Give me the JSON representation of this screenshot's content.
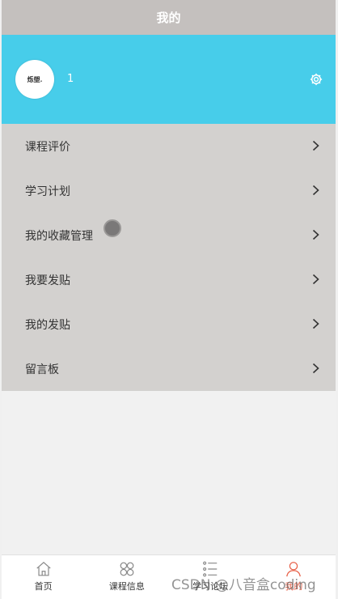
{
  "header": {
    "title": "我的"
  },
  "profile": {
    "avatar_text": "烁塑.",
    "username": "1",
    "settings_icon": "gear-icon",
    "background": "#47cdea"
  },
  "menu": {
    "items": [
      {
        "label": "课程评价",
        "icon": "chevron-right-icon"
      },
      {
        "label": "学习计划",
        "icon": "chevron-right-icon"
      },
      {
        "label": "我的收藏管理",
        "icon": "chevron-right-icon"
      },
      {
        "label": "我要发贴",
        "icon": "chevron-right-icon"
      },
      {
        "label": "我的发贴",
        "icon": "chevron-right-icon"
      },
      {
        "label": "留言板",
        "icon": "chevron-right-icon"
      }
    ]
  },
  "tabbar": {
    "tabs": [
      {
        "label": "首页",
        "icon": "home-icon",
        "active": false
      },
      {
        "label": "课程信息",
        "icon": "grid-icon",
        "active": false
      },
      {
        "label": "学习论坛",
        "icon": "list-icon",
        "active": false
      },
      {
        "label": "我的",
        "icon": "user-icon",
        "active": true
      }
    ],
    "active_color": "#e8624a"
  },
  "watermark": "CSDN @八音盒coding"
}
